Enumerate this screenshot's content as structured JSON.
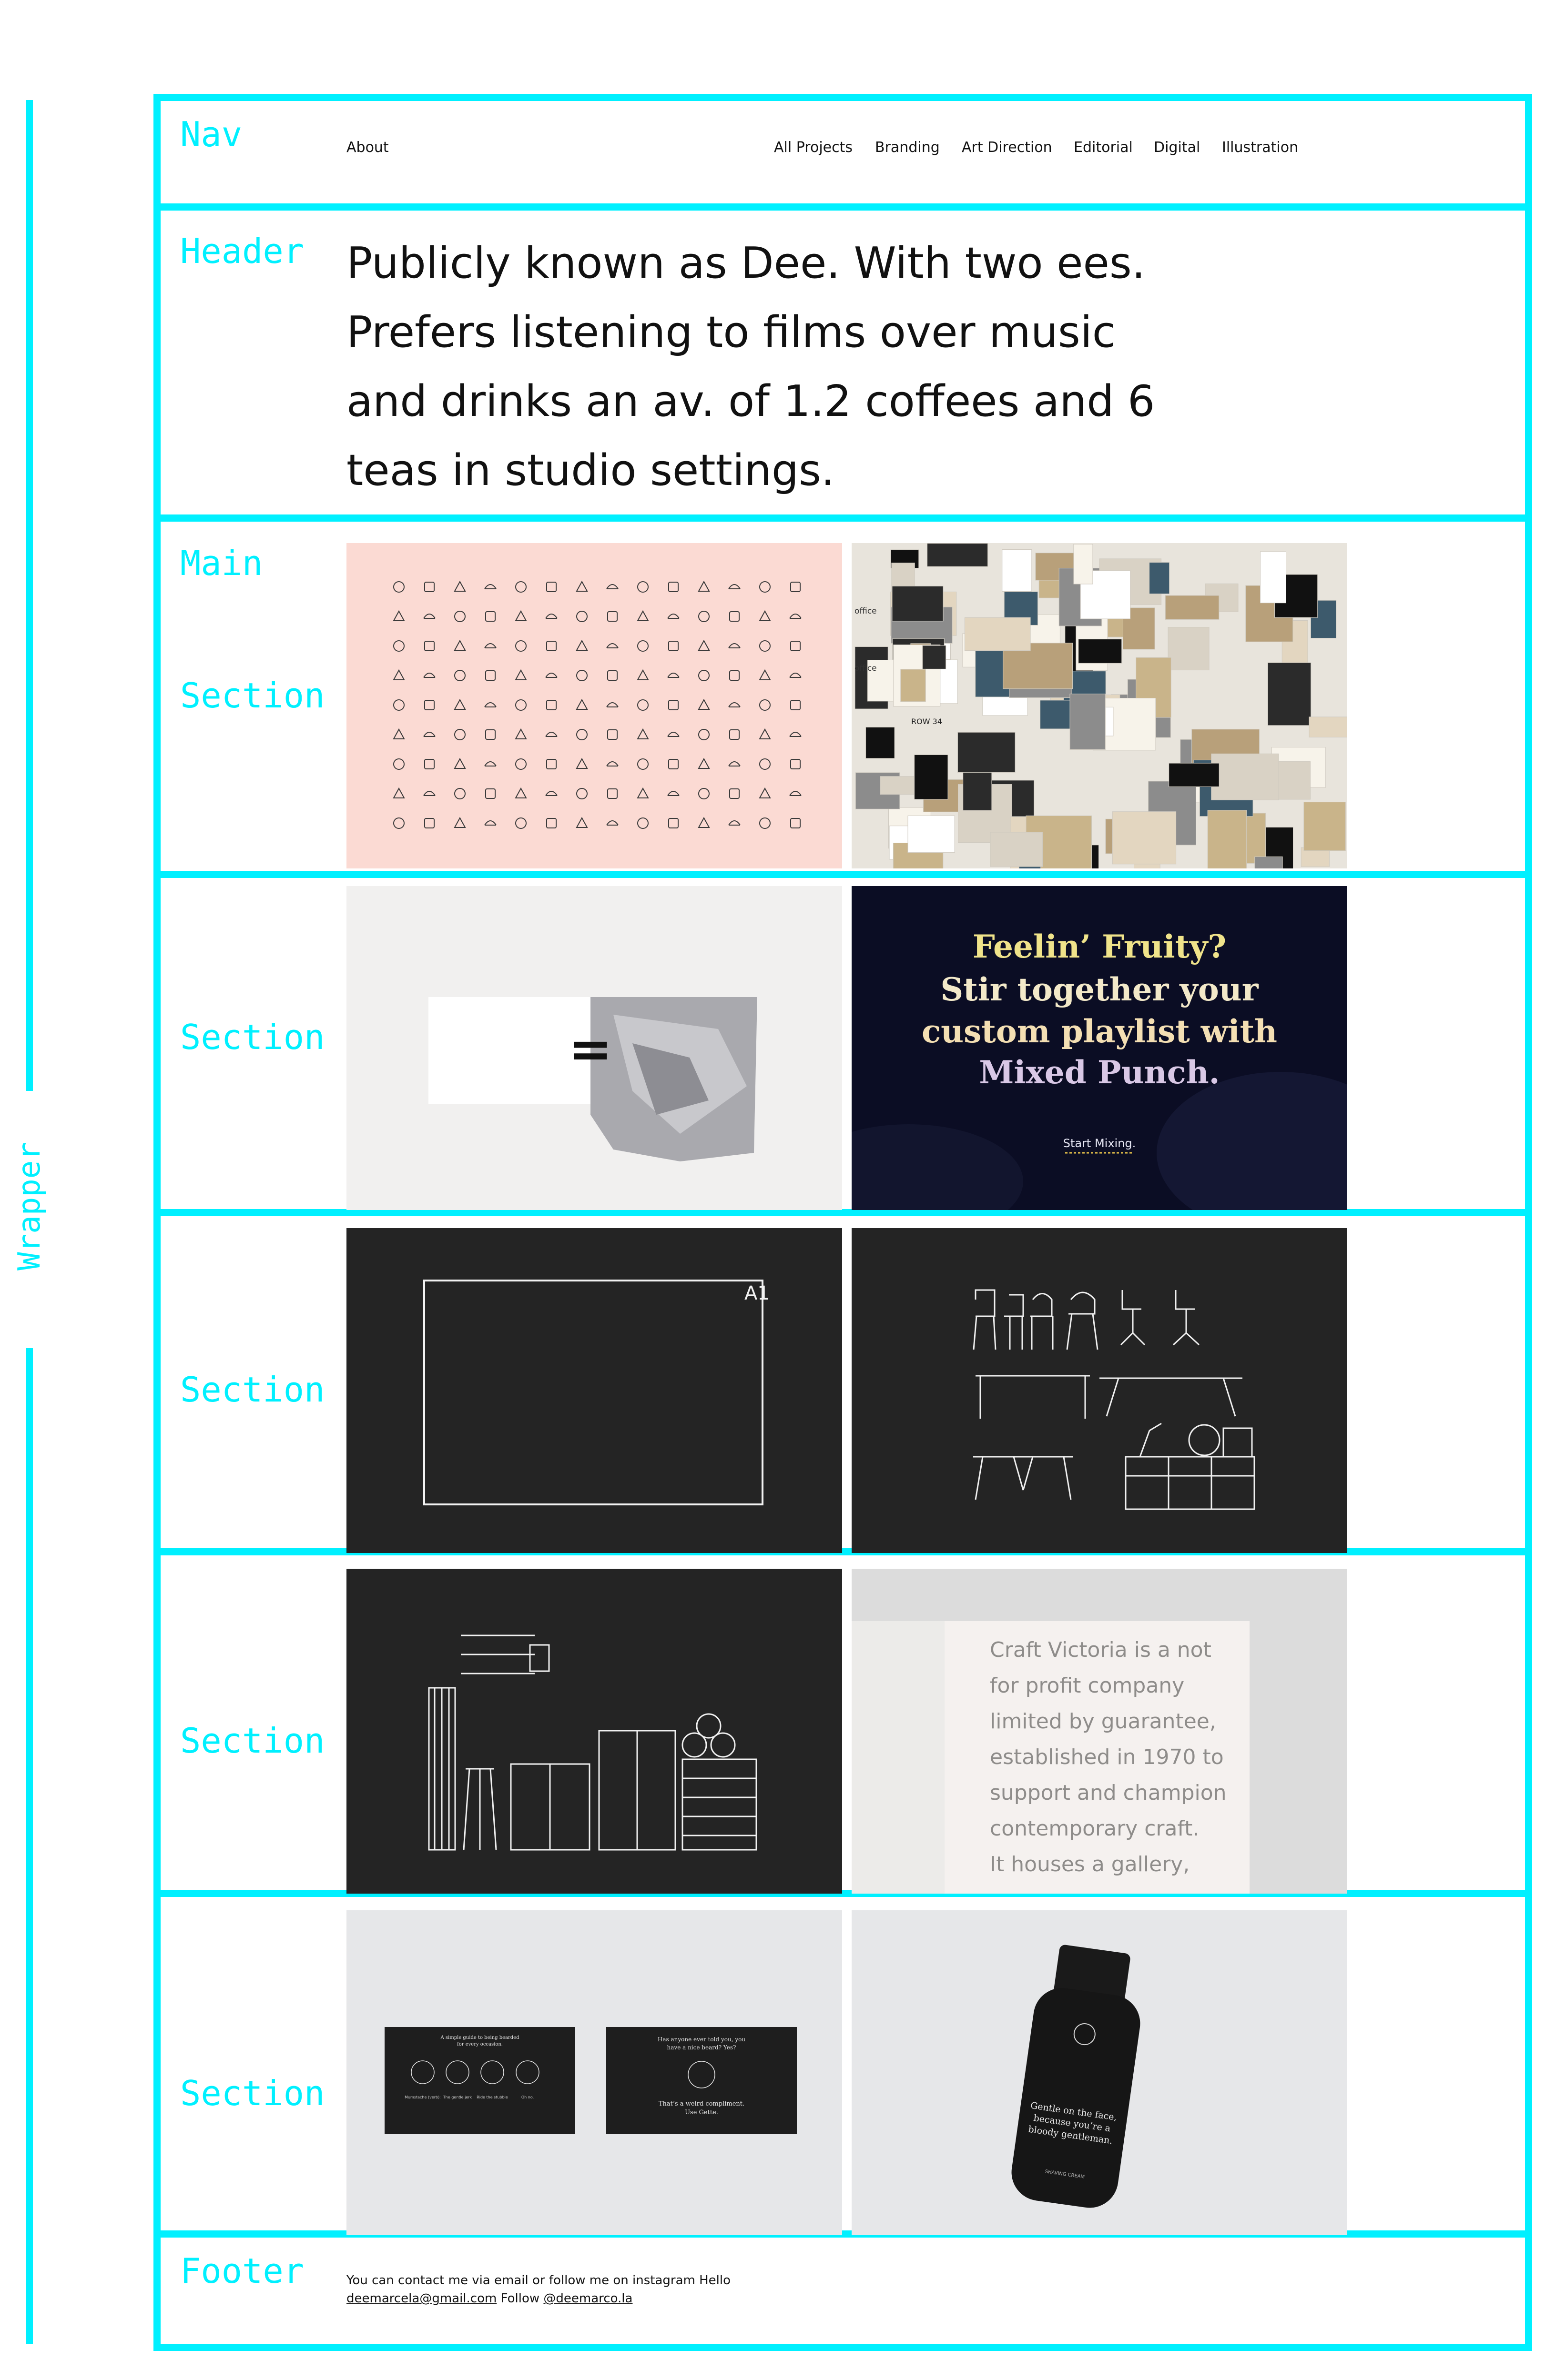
{
  "wireframe": {
    "wrapper_label": "Wrapper",
    "nav_label": "Nav",
    "header_label": "Header",
    "main_label": "Main",
    "section_label": "Section",
    "footer_label": "Footer",
    "accent_color": "#00f0ff"
  },
  "nav": {
    "about": "About",
    "links": [
      "All Projects",
      "Branding",
      "Art Direction",
      "Editorial",
      "Digital",
      "Illustration"
    ]
  },
  "header": {
    "lines": [
      "Publicly known as Dee. With two ees.",
      "Prefers listening to films over music",
      "and drinks an av. of 1.2 coffees and 6",
      "teas in studio settings."
    ]
  },
  "sections": [
    {
      "left": {
        "name": "icon-grid-project"
      },
      "right": {
        "name": "moodboard-wall-project",
        "captions": [
          "office",
          "office",
          "ROW 34"
        ]
      }
    },
    {
      "left": {
        "name": "equals-rock-project",
        "symbol": "="
      },
      "right": {
        "name": "mixed-punch-project",
        "headline": [
          "Feelin’ Fruity?",
          "Stir together your",
          "custom playlist with",
          "Mixed Punch."
        ],
        "cta": "Start Mixing."
      }
    },
    {
      "left": {
        "name": "a1-frame-project",
        "label": "A1"
      },
      "right": {
        "name": "furniture-drawing-project"
      }
    },
    {
      "left": {
        "name": "storage-drawing-project"
      },
      "right": {
        "name": "craft-victoria-project",
        "text": [
          "Craft Victoria is a not",
          "for profit company",
          "limited by guarantee,",
          "established in 1970 to",
          "support and champion",
          "contemporary craft.",
          "It houses a gallery,"
        ]
      }
    },
    {
      "left": {
        "name": "grooming-cards-project",
        "card1_title": [
          "A simple guide to being bearded",
          "for every occasion."
        ],
        "card1_captions": [
          "Mumstache (verb):",
          "The gentle jerk",
          "Ride the stubble",
          "Oh no."
        ],
        "card2_title": [
          "Has anyone ever told you, you",
          "have a nice beard? Yes?"
        ],
        "card2_body": [
          "That’s a weird compliment.",
          "Use Gette."
        ]
      },
      "right": {
        "name": "shaving-bottle-project",
        "label": [
          "Gentle on the face,",
          "because you’re a",
          "bloody gentleman."
        ],
        "sub": "SHAVING CREAM"
      }
    }
  ],
  "footer": {
    "intro": "You can contact me via email or follow me on instagram Hello",
    "email": "deemarcela@gmail.com",
    "follow": "Follow",
    "instagram": "@deemarco.la"
  }
}
